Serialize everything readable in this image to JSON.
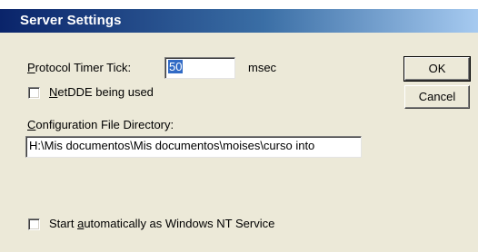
{
  "dialog": {
    "title": "Server Settings",
    "protocol_timer": {
      "label_accel": "P",
      "label_rest": "rotocol Timer Tick:",
      "value": "50",
      "unit": "msec"
    },
    "netdde": {
      "label_accel": "N",
      "label_rest": "etDDE being used",
      "checked": false
    },
    "config_dir": {
      "label_accel": "C",
      "label_rest": "onfiguration File Directory:",
      "value": "H:\\Mis documentos\\Mis documentos\\moises\\curso into"
    },
    "autostart": {
      "label_before": "Start ",
      "label_accel": "a",
      "label_rest": "utomatically as Windows NT Service",
      "checked": false
    },
    "buttons": {
      "ok": "OK",
      "cancel": "Cancel"
    }
  }
}
